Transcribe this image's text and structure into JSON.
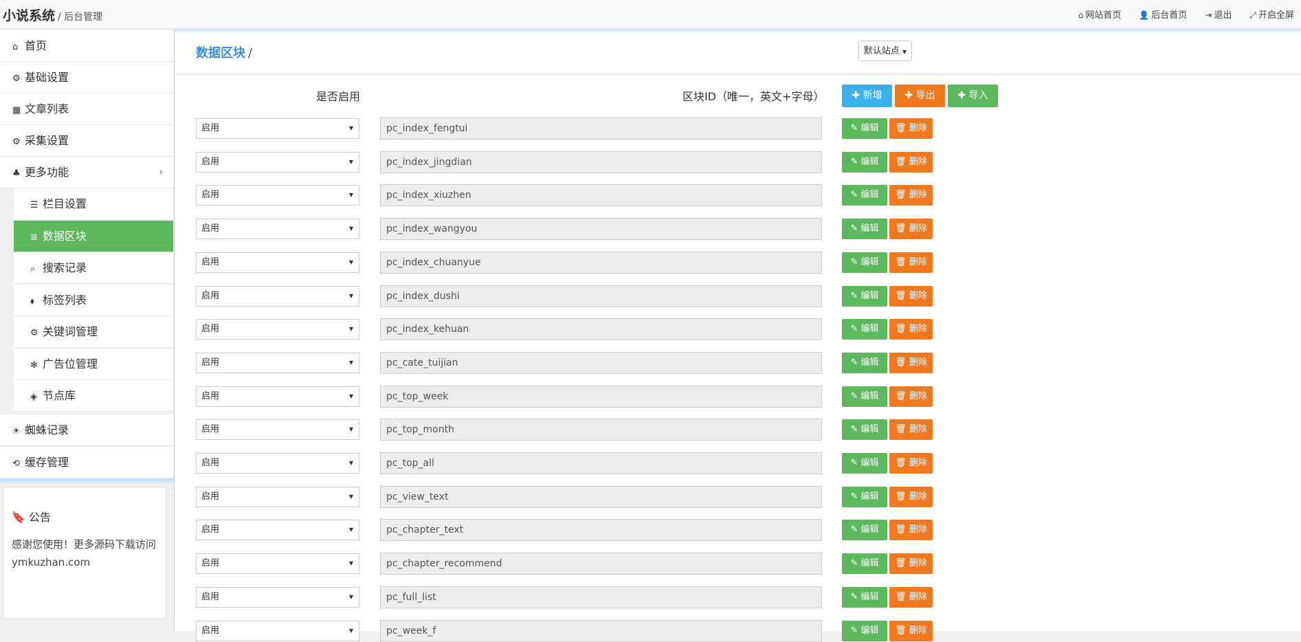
{
  "app": {
    "brand": "小说系统",
    "sub_title": "后台管理",
    "top_links": [
      {
        "icon": "home-icon",
        "glyph": "⌂",
        "label": "网站首页"
      },
      {
        "icon": "user-icon",
        "glyph": "👤",
        "label": "后台首页"
      },
      {
        "icon": "logout-icon",
        "glyph": "⇥",
        "label": "退出"
      },
      {
        "icon": "fullscreen-icon",
        "glyph": "⤢",
        "label": "开启全屏"
      }
    ]
  },
  "sidebar": {
    "items": [
      {
        "glyph": "⌂",
        "label": "首页"
      },
      {
        "glyph": "⚙",
        "label": "基础设置"
      },
      {
        "glyph": "▦",
        "label": "文章列表"
      },
      {
        "glyph": "⚙",
        "label": "采集设置"
      },
      {
        "glyph": "♣",
        "label": "更多功能",
        "chevron": "›"
      }
    ],
    "sub_items": [
      {
        "glyph": "☰",
        "label": "栏目设置"
      },
      {
        "glyph": "≣",
        "label": "数据区块"
      },
      {
        "glyph": "⌕",
        "label": "搜索记录"
      },
      {
        "glyph": "⬧",
        "label": "标签列表"
      },
      {
        "glyph": "⚙",
        "label": "关键词管理"
      },
      {
        "glyph": "✻",
        "label": "广告位管理"
      },
      {
        "glyph": "◈",
        "label": "节点库"
      }
    ],
    "bottom_items": [
      {
        "glyph": "☀",
        "label": "蜘蛛记录"
      },
      {
        "glyph": "⟲",
        "label": "缓存管理"
      }
    ]
  },
  "notice": {
    "title": "公告",
    "content": "感谢您使用！更多源码下载访问ymkuzhan.com"
  },
  "page": {
    "breadcrumb": "数据区块",
    "separator": "/",
    "site_select": "默认站点",
    "col_enabled": "是否启用",
    "col_id": "区块ID（唯一，英文+字母）",
    "btn_add": "新增",
    "btn_export": "导出",
    "btn_import": "导入",
    "btn_edit": "编辑",
    "btn_delete": "删除"
  },
  "rows": [
    {
      "status": "启用",
      "block_id": "pc_index_fengtui"
    },
    {
      "status": "启用",
      "block_id": "pc_index_jingdian"
    },
    {
      "status": "启用",
      "block_id": "pc_index_xiuzhen"
    },
    {
      "status": "启用",
      "block_id": "pc_index_wangyou"
    },
    {
      "status": "启用",
      "block_id": "pc_index_chuanyue"
    },
    {
      "status": "启用",
      "block_id": "pc_index_dushi"
    },
    {
      "status": "启用",
      "block_id": "pc_index_kehuan"
    },
    {
      "status": "启用",
      "block_id": "pc_cate_tuijian"
    },
    {
      "status": "启用",
      "block_id": "pc_top_week"
    },
    {
      "status": "启用",
      "block_id": "pc_top_month"
    },
    {
      "status": "启用",
      "block_id": "pc_top_all"
    },
    {
      "status": "启用",
      "block_id": "pc_view_text"
    },
    {
      "status": "启用",
      "block_id": "pc_chapter_text"
    },
    {
      "status": "启用",
      "block_id": "pc_chapter_recommend"
    },
    {
      "status": "启用",
      "block_id": "pc_full_list"
    },
    {
      "status": "启用",
      "block_id": "pc_week_f"
    }
  ]
}
